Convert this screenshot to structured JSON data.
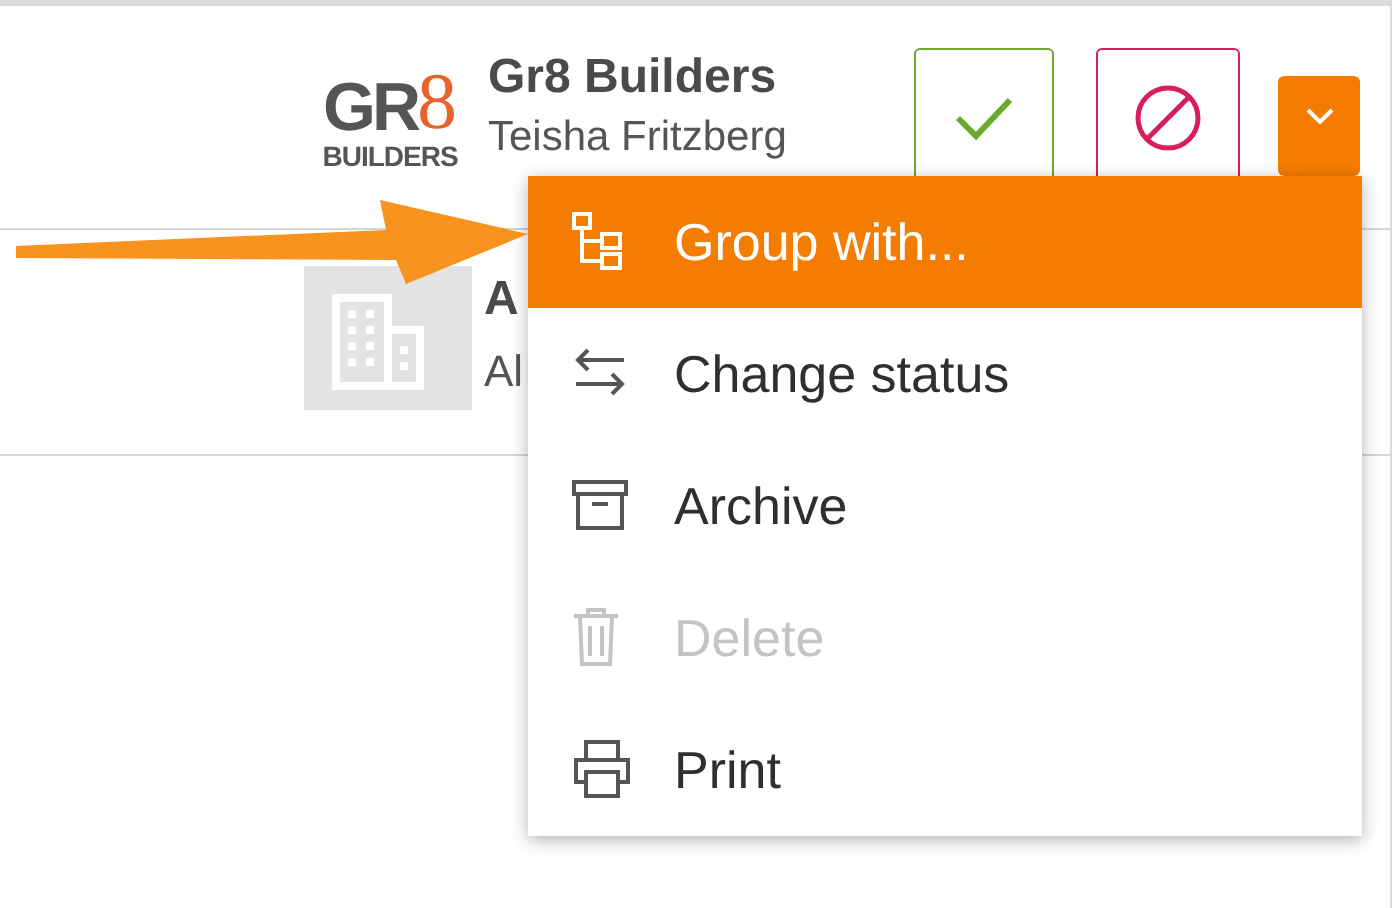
{
  "rows": [
    {
      "logo": {
        "kind": "gr8",
        "top": "GR",
        "accent": "8",
        "bottom": "BUILDERS"
      },
      "title": "Gr8 Builders",
      "subtitle": "Teisha Fritzberg"
    },
    {
      "logo": {
        "kind": "building"
      },
      "title": "A",
      "subtitle": "Al"
    }
  ],
  "menu": {
    "items": [
      {
        "label": "Group with...",
        "kind": "tree",
        "selected": true,
        "disabled": false
      },
      {
        "label": "Change status",
        "kind": "swap",
        "selected": false,
        "disabled": false
      },
      {
        "label": "Archive",
        "kind": "archive",
        "selected": false,
        "disabled": false
      },
      {
        "label": "Delete",
        "kind": "trash",
        "selected": false,
        "disabled": true
      },
      {
        "label": "Print",
        "kind": "printer",
        "selected": false,
        "disabled": false
      }
    ]
  }
}
